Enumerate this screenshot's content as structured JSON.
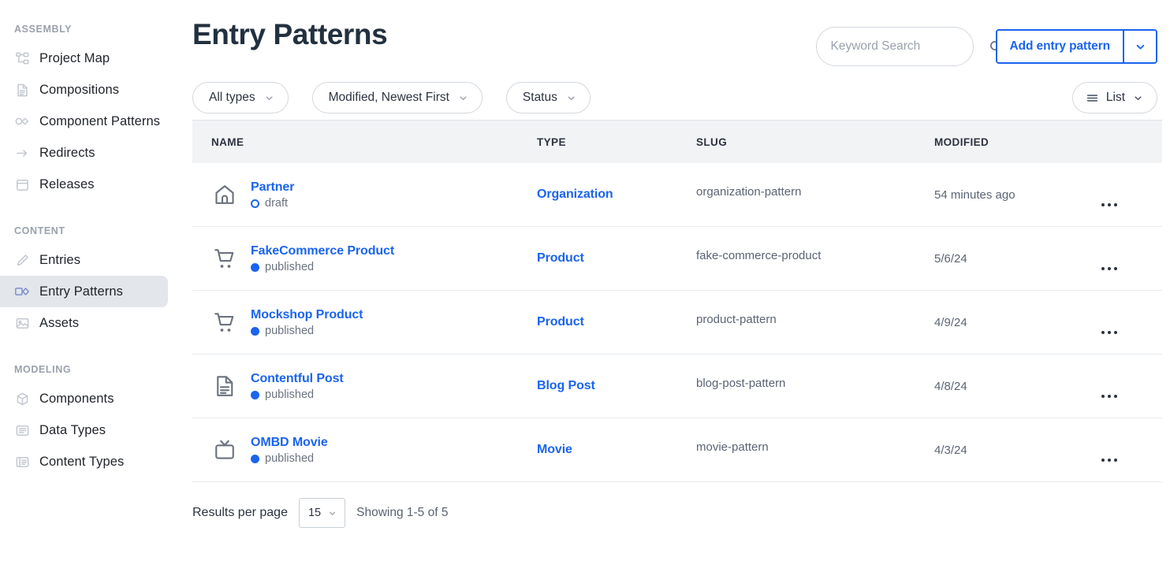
{
  "sidebar": {
    "groups": [
      {
        "label": "ASSEMBLY",
        "items": [
          {
            "label": "Project Map",
            "icon": "project-map-icon",
            "active": false
          },
          {
            "label": "Compositions",
            "icon": "document-icon",
            "active": false
          },
          {
            "label": "Component Patterns",
            "icon": "component-patterns-icon",
            "active": false
          },
          {
            "label": "Redirects",
            "icon": "arrow-right-icon",
            "active": false
          },
          {
            "label": "Releases",
            "icon": "calendar-icon",
            "active": false
          }
        ]
      },
      {
        "label": "CONTENT",
        "items": [
          {
            "label": "Entries",
            "icon": "pencil-icon",
            "active": false
          },
          {
            "label": "Entry Patterns",
            "icon": "entry-pattern-icon",
            "active": true
          },
          {
            "label": "Assets",
            "icon": "image-icon",
            "active": false
          }
        ]
      },
      {
        "label": "MODELING",
        "items": [
          {
            "label": "Components",
            "icon": "cube-icon",
            "active": false
          },
          {
            "label": "Data Types",
            "icon": "data-types-icon",
            "active": false
          },
          {
            "label": "Content Types",
            "icon": "content-type-icon",
            "active": false
          }
        ]
      }
    ]
  },
  "header": {
    "title": "Entry Patterns",
    "search": {
      "value": "",
      "placeholder": "Keyword Search",
      "icon": "search-icon"
    },
    "add_button": {
      "label": "Add entry pattern",
      "caret_icon": "chevron-down-icon"
    }
  },
  "filters": {
    "type": {
      "label": "All types",
      "caret_icon": "chevron-down-icon"
    },
    "sort": {
      "label": "Modified, Newest First",
      "caret_icon": "chevron-down-icon"
    },
    "status": {
      "label": "Status",
      "caret_icon": "chevron-down-icon"
    },
    "view": {
      "label": "List",
      "icon": "list-view-icon",
      "caret_icon": "chevron-down-icon"
    }
  },
  "table": {
    "columns": [
      "NAME",
      "TYPE",
      "SLUG",
      "MODIFIED"
    ],
    "rows": [
      {
        "name": "Partner",
        "icon": "home-icon",
        "status": "draft",
        "status_state": "draft",
        "type": "Organization",
        "slug": "organization-pattern",
        "modified": "54 minutes ago"
      },
      {
        "name": "FakeCommerce Product",
        "icon": "cart-icon",
        "status": "published",
        "status_state": "published",
        "type": "Product",
        "slug": "fake-commerce-product",
        "modified": "5/6/24"
      },
      {
        "name": "Mockshop Product",
        "icon": "cart-icon",
        "status": "published",
        "status_state": "published",
        "type": "Product",
        "slug": "product-pattern",
        "modified": "4/9/24"
      },
      {
        "name": "Contentful Post",
        "icon": "document-icon",
        "status": "published",
        "status_state": "published",
        "type": "Blog Post",
        "slug": "blog-post-pattern",
        "modified": "4/8/24"
      },
      {
        "name": "OMBD Movie",
        "icon": "tv-icon",
        "status": "published",
        "status_state": "published",
        "type": "Movie",
        "slug": "movie-pattern",
        "modified": "4/3/24"
      }
    ],
    "row_menu_icon": "ellipsis-icon"
  },
  "footer": {
    "results_per_page_label": "Results per page",
    "results_per_page_value": "15",
    "showing": "Showing 1-5 of 5",
    "caret_icon": "chevron-down-icon"
  },
  "colors": {
    "accent": "#1a64f0",
    "text": "#2c3340",
    "muted": "#5a6475",
    "header_bg": "#f1f3f5",
    "active_nav_bg": "#e3e6ea"
  }
}
